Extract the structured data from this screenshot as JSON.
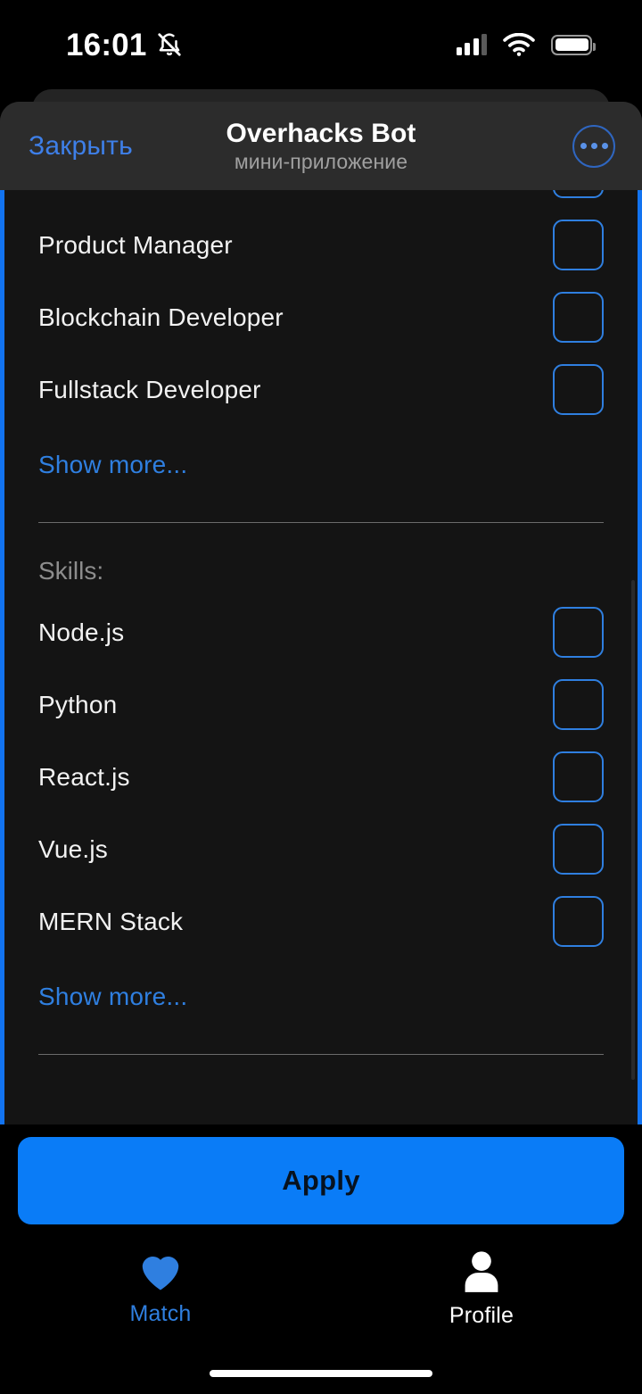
{
  "status_bar": {
    "time": "16:01",
    "mute_icon": "bell-slash-icon",
    "signal_icon": "cellular-signal-icon",
    "wifi_icon": "wifi-icon",
    "battery_icon": "battery-full-icon"
  },
  "nav": {
    "close_label": "Закрыть",
    "title": "Overhacks Bot",
    "subtitle": "мини-приложение",
    "more_icon": "ellipsis-circle-icon"
  },
  "content": {
    "positions": {
      "items": [
        {
          "label": "Product Manager",
          "checked": false
        },
        {
          "label": "Blockchain Developer",
          "checked": false
        },
        {
          "label": "Fullstack Developer",
          "checked": false
        }
      ],
      "show_more_label": "Show more..."
    },
    "skills": {
      "heading": "Skills:",
      "items": [
        {
          "label": "Node.js",
          "checked": false
        },
        {
          "label": "Python",
          "checked": false
        },
        {
          "label": "React.js",
          "checked": false
        },
        {
          "label": "Vue.js",
          "checked": false
        },
        {
          "label": "MERN Stack",
          "checked": false
        }
      ],
      "show_more_label": "Show more..."
    }
  },
  "apply_button": {
    "label": "Apply"
  },
  "tab_bar": {
    "tabs": [
      {
        "label": "Match",
        "icon": "heart-icon",
        "active": true
      },
      {
        "label": "Profile",
        "icon": "person-icon",
        "active": false
      }
    ]
  },
  "colors": {
    "accent_blue": "#0a7cf7",
    "link_blue": "#2f7fe0",
    "sheet_bg": "#2c2c2c",
    "content_bg": "#141414",
    "page_bg": "#000000"
  }
}
